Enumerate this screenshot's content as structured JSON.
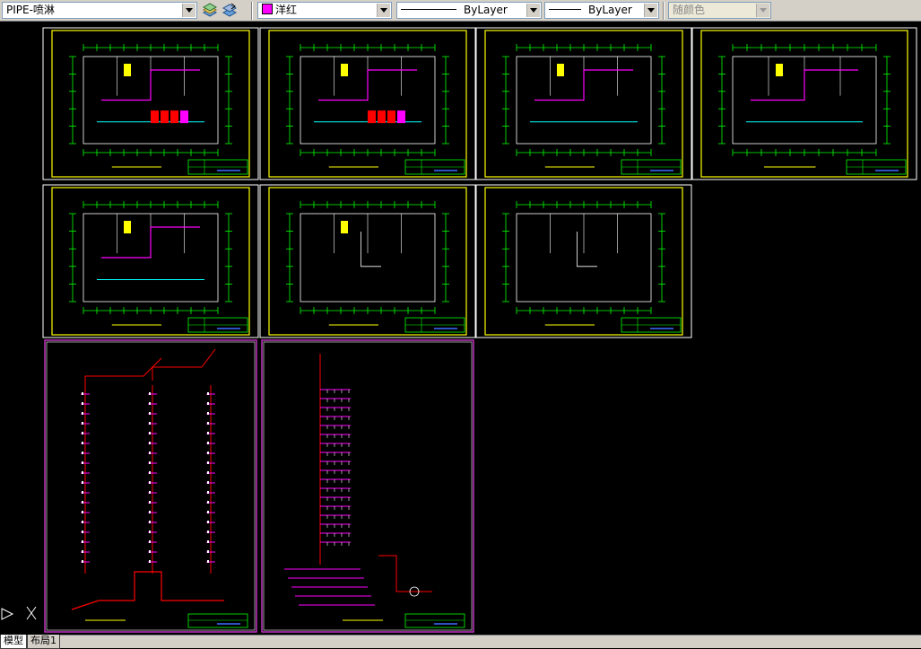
{
  "toolbar": {
    "layer_name": "PIPE-喷淋",
    "color_name": "洋红",
    "color_hex": "#ff00ff",
    "linetype": "ByLayer",
    "lineweight": "ByLayer",
    "plot_style": "随颜色"
  },
  "drawing": {
    "colors": {
      "background": "#000000",
      "frame_yellow": "#ffff00",
      "frame_magenta": "#cc33cc",
      "green": "#00ff00",
      "magenta": "#ff00ff",
      "cyan": "#00ffff",
      "red": "#ff0000",
      "white": "#ffffff"
    },
    "ucs_icon": "ucs-icon"
  },
  "tabs": [
    "模型",
    "布局1"
  ]
}
